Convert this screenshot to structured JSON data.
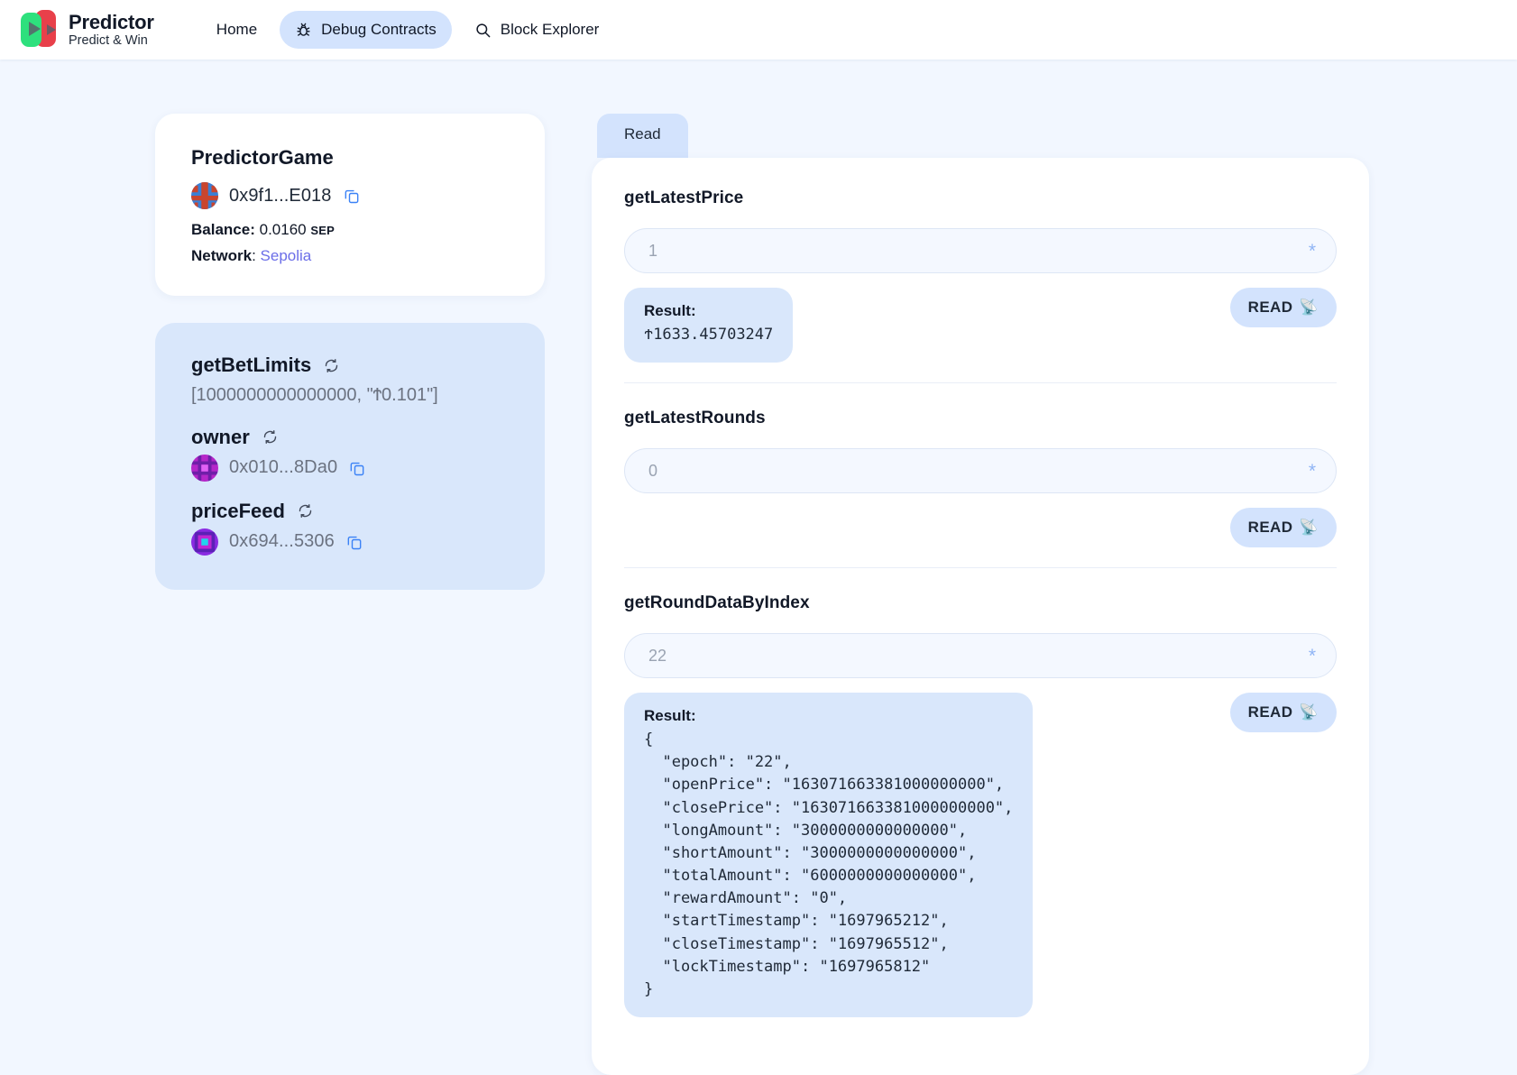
{
  "navbar": {
    "brand": {
      "title": "Predictor",
      "subtitle": "Predict & Win"
    },
    "links": [
      {
        "label": "Home",
        "icon": "",
        "active": false
      },
      {
        "label": "Debug Contracts",
        "icon": "bug-icon",
        "active": true
      },
      {
        "label": "Block Explorer",
        "icon": "search-icon",
        "active": false
      }
    ]
  },
  "contract_card": {
    "name": "PredictorGame",
    "address": "0x9f1...E018",
    "balance_label": "Balance:",
    "balance_value": "0.0160",
    "balance_unit": "SEP",
    "network_label": "Network",
    "network_value": "Sepolia",
    "network_color": "#6b6ee8"
  },
  "variables": [
    {
      "name": "getBetLimits",
      "value": "[1000000000000000, \"Ϯ0.101\"]",
      "type": "value"
    },
    {
      "name": "owner",
      "value": "0x010...8Da0",
      "type": "address"
    },
    {
      "name": "priceFeed",
      "value": "0x694...5306",
      "type": "address"
    }
  ],
  "tabs": [
    {
      "label": "Read",
      "active": true
    }
  ],
  "functions": [
    {
      "name": "getLatestPrice",
      "input_placeholder": "1",
      "input_value": "",
      "asterisk": "*",
      "read_label": "READ",
      "read_icon": "📡",
      "result_label": "Result:",
      "result_value": "Ϯ1633.45703247",
      "has_result": true
    },
    {
      "name": "getLatestRounds",
      "input_placeholder": "0",
      "input_value": "",
      "asterisk": "*",
      "read_label": "READ",
      "read_icon": "📡",
      "result_label": "",
      "result_value": "",
      "has_result": false
    },
    {
      "name": "getRoundDataByIndex",
      "input_placeholder": "22",
      "input_value": "",
      "asterisk": "*",
      "read_label": "READ",
      "read_icon": "📡",
      "result_label": "Result:",
      "result_value": "{\n  \"epoch\": \"22\",\n  \"openPrice\": \"163071663381000000000\",\n  \"closePrice\": \"163071663381000000000\",\n  \"longAmount\": \"3000000000000000\",\n  \"shortAmount\": \"3000000000000000\",\n  \"totalAmount\": \"6000000000000000\",\n  \"rewardAmount\": \"0\",\n  \"startTimestamp\": \"1697965212\",\n  \"closeTimestamp\": \"1697965512\",\n  \"lockTimestamp\": \"1697965812\"\n}",
      "has_result": true
    }
  ],
  "colors": {
    "page_bg": "#f2f7ff",
    "accent": "#d3e3fd",
    "result_bg": "#d9e7fb",
    "text": "#111827"
  }
}
